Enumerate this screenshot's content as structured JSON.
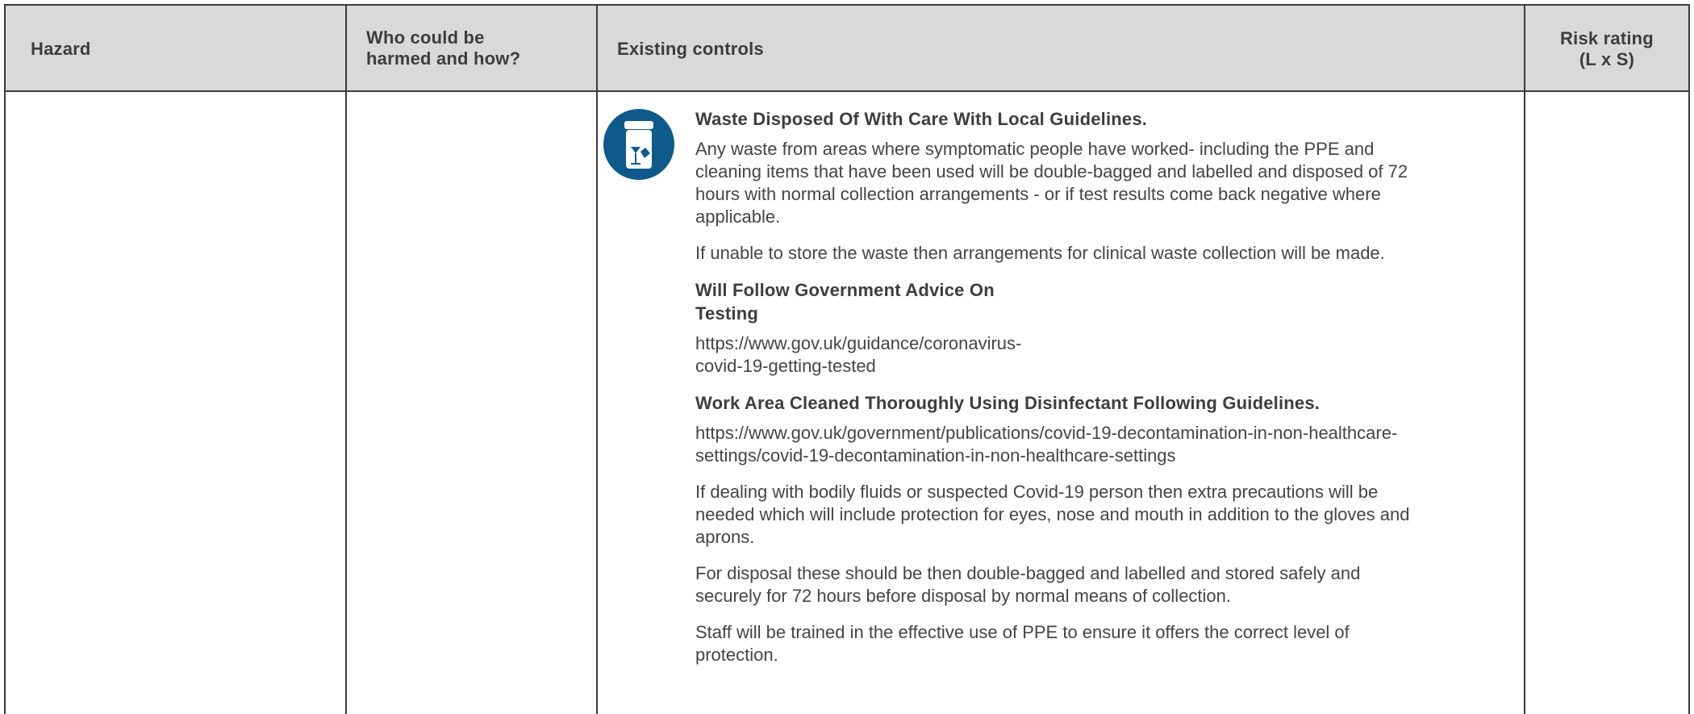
{
  "table": {
    "headers": {
      "hazard": "Hazard",
      "who_harmed": "Who could be\nharmed and how?",
      "existing_controls": "Existing controls",
      "risk_rating": "Risk rating\n(L x S)"
    },
    "icon": "waste-bin-icon",
    "accent_color": "#0e5a8a",
    "header_bg": "#d9d9d9",
    "sections": [
      {
        "title": "Waste Disposed Of With Care With Local Guidelines.",
        "paragraphs": [
          "Any waste from areas where symptomatic people have worked- including the PPE and\ncleaning items that have been used will be double-bagged and labelled and disposed of 72\nhours with normal collection arrangements - or if test results come back negative where\napplicable.",
          "If unable to store the waste then arrangements for clinical waste collection will be made."
        ]
      },
      {
        "title": "Will Follow Government Advice On\nTesting",
        "paragraphs": [
          "https://www.gov.uk/guidance/coronavirus-\ncovid-19-getting-tested"
        ]
      },
      {
        "title": "Work Area Cleaned Thoroughly Using Disinfectant Following Guidelines.",
        "paragraphs": [
          "https://www.gov.uk/government/publications/covid-19-decontamination-in-non-healthcare-\nsettings/covid-19-decontamination-in-non-healthcare-settings",
          "If dealing with bodily fluids or suspected Covid-19 person then extra precautions will be\nneeded which will include protection for eyes, nose and mouth in addition to the gloves and\naprons.",
          "For disposal these should be then double-bagged and labelled and stored safely and\nsecurely for 72 hours before disposal by normal means of collection.",
          "Staff will be trained in the effective use of PPE to ensure it offers the correct level of\nprotection."
        ]
      }
    ]
  }
}
